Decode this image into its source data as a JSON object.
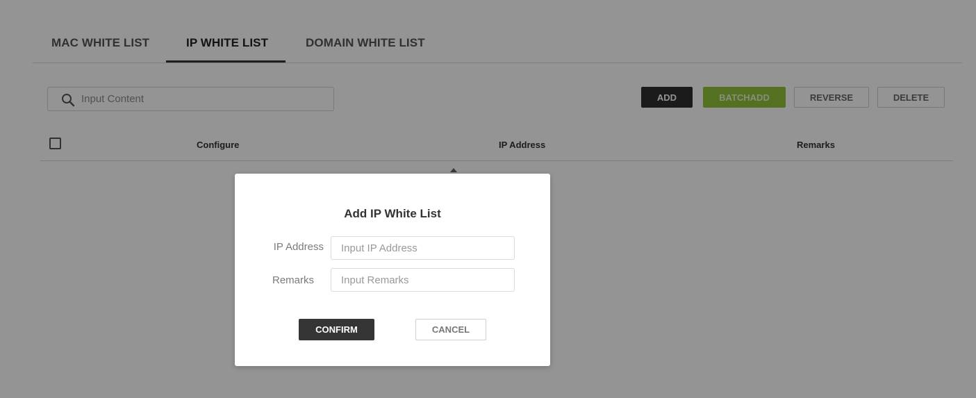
{
  "tabs": [
    {
      "label": "MAC WHITE LIST",
      "active": false
    },
    {
      "label": "IP WHITE LIST",
      "active": true
    },
    {
      "label": "DOMAIN WHITE LIST",
      "active": false
    }
  ],
  "search": {
    "placeholder": "Input Content",
    "icon": "search-icon"
  },
  "toolbar": {
    "add_label": "ADD",
    "batchadd_label": "BATCHADD",
    "reverse_label": "REVERSE",
    "delete_label": "DELETE"
  },
  "table": {
    "columns": [
      "Configure",
      "IP Address",
      "Remarks"
    ],
    "rows": []
  },
  "modal": {
    "title": "Add IP White List",
    "ip_label": "IP Address",
    "ip_placeholder": "Input IP Address",
    "remarks_label": "Remarks",
    "remarks_placeholder": "Input Remarks",
    "confirm_label": "CONFIRM",
    "cancel_label": "CANCEL"
  },
  "colors": {
    "accent_green": "#92c13a",
    "dark_button": "#2f2f2f",
    "overlay": "rgba(0,0,0,0.42)"
  }
}
